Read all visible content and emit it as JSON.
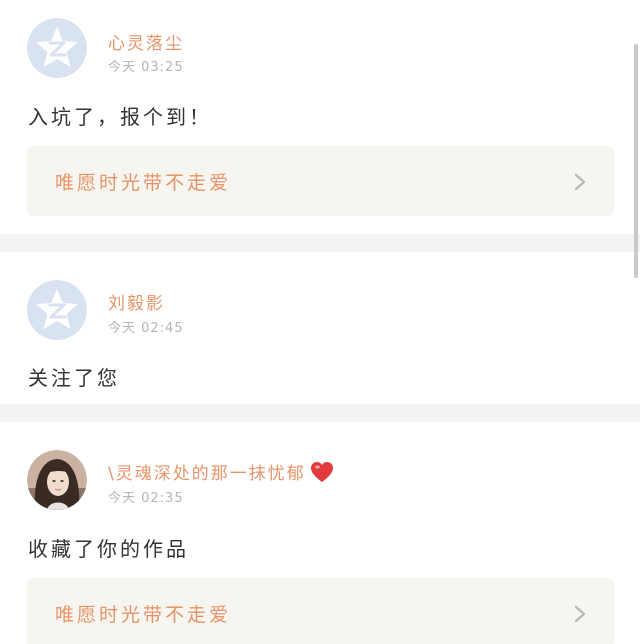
{
  "notifications": [
    {
      "avatar": "qzone-star-default-avatar",
      "username": "心灵落尘",
      "time": "今天 03:25",
      "message": "入坑了，报个到！",
      "work_title": "唯愿时光带不走爱"
    },
    {
      "avatar": "qzone-star-default-avatar",
      "username": "刘毅影",
      "time": "今天 02:45",
      "message": "关注了您"
    },
    {
      "avatar": "user-photo-avatar",
      "username": "\\灵魂深处的那一抹忧郁",
      "username_emoji": "heart-emoji",
      "time": "今天 02:35",
      "message": "收藏了你的作品",
      "work_title": "唯愿时光带不走爱"
    }
  ],
  "colors": {
    "username": "#e8946a",
    "time": "#b5b5b5",
    "message": "#333333",
    "card_link_bg": "#f6f5f0",
    "separator": "#f3f3f1",
    "avatar_default": "#d8e2f0",
    "heart": "#e23b3b"
  },
  "icons": {
    "chevron": "chevron-right-icon"
  }
}
